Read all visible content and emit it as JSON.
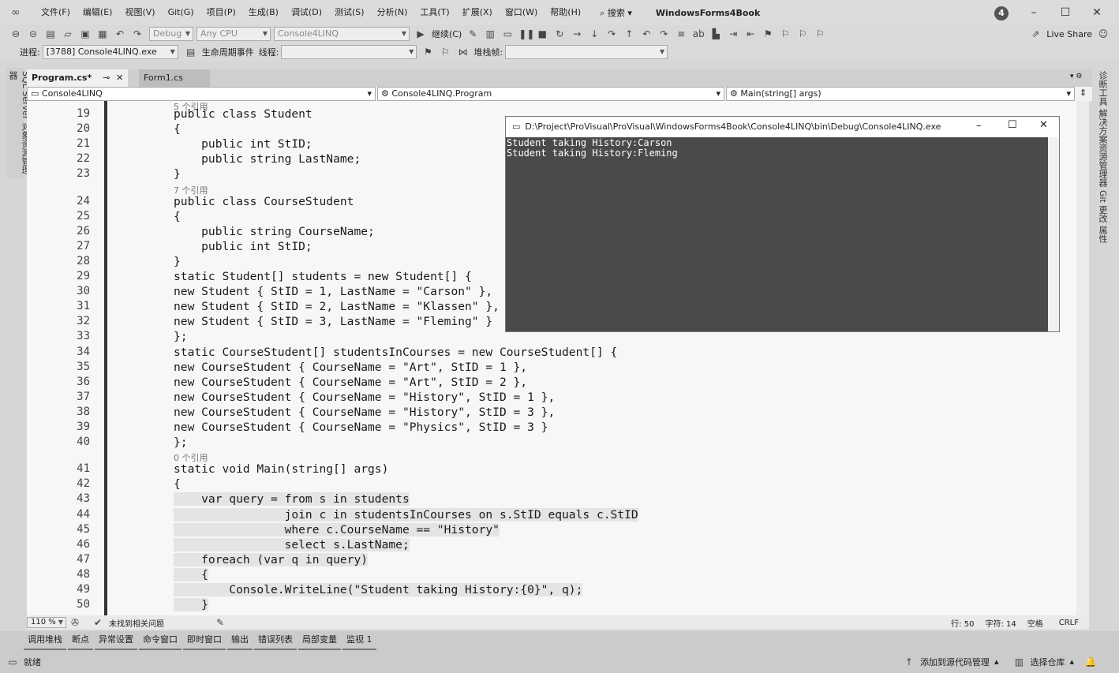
{
  "titlebar": {
    "menus": [
      "文件(F)",
      "编辑(E)",
      "视图(V)",
      "Git(G)",
      "项目(P)",
      "生成(B)",
      "调试(D)",
      "测试(S)",
      "分析(N)",
      "工具(T)",
      "扩展(X)",
      "窗口(W)",
      "帮助(H)"
    ],
    "search_label": "搜索",
    "window_title": "WindowsForms4Book",
    "badge": "4"
  },
  "toolbar1": {
    "config": "Debug",
    "platform": "Any CPU",
    "project": "Console4LINQ",
    "continue_label": "继续(C)",
    "live_share": "Live Share"
  },
  "toolbar2": {
    "process_label": "进程:",
    "process_value": "[3788] Console4LINQ.exe",
    "lifecycle_label": "生命周期事件",
    "thread_label": "线程:",
    "stack_label": "堆栈帧:"
  },
  "left_tab": [
    "SQL Server 对象资源管理器"
  ],
  "right_tab": [
    "诊断工具",
    "解决方案资源管理器",
    "Git 更改",
    "属性"
  ],
  "editor_tabs": [
    "Program.cs*",
    "Form1.cs"
  ],
  "nav": {
    "project": "Console4LINQ",
    "class": "Console4LINQ.Program",
    "member": "Main(string[] args)"
  },
  "code_lines": [
    {
      "n": "19",
      "text": "public class Student",
      "ref": "5 个引用"
    },
    {
      "n": "20",
      "text": "{"
    },
    {
      "n": "21",
      "text": "    public int StID;"
    },
    {
      "n": "22",
      "text": "    public string LastName;"
    },
    {
      "n": "23",
      "text": "}"
    },
    {
      "n": "24",
      "text": "public class CourseStudent",
      "ref": "7 个引用"
    },
    {
      "n": "25",
      "text": "{"
    },
    {
      "n": "26",
      "text": "    public string CourseName;"
    },
    {
      "n": "27",
      "text": "    public int StID;"
    },
    {
      "n": "28",
      "text": "}"
    },
    {
      "n": "29",
      "text": "static Student[] students = new Student[] {"
    },
    {
      "n": "30",
      "text": "new Student { StID = 1, LastName = \"Carson\" },"
    },
    {
      "n": "31",
      "text": "new Student { StID = 2, LastName = \"Klassen\" },"
    },
    {
      "n": "32",
      "text": "new Student { StID = 3, LastName = \"Fleming\" }"
    },
    {
      "n": "33",
      "text": "};"
    },
    {
      "n": "34",
      "text": "static CourseStudent[] studentsInCourses = new CourseStudent[] {"
    },
    {
      "n": "35",
      "text": "new CourseStudent { CourseName = \"Art\", StID = 1 },"
    },
    {
      "n": "36",
      "text": "new CourseStudent { CourseName = \"Art\", StID = 2 },"
    },
    {
      "n": "37",
      "text": "new CourseStudent { CourseName = \"History\", StID = 1 },"
    },
    {
      "n": "38",
      "text": "new CourseStudent { CourseName = \"History\", StID = 3 },"
    },
    {
      "n": "39",
      "text": "new CourseStudent { CourseName = \"Physics\", StID = 3 }"
    },
    {
      "n": "40",
      "text": "};"
    },
    {
      "n": "41",
      "text": "static void Main(string[] args)",
      "ref": "0 个引用"
    },
    {
      "n": "42",
      "text": "{"
    },
    {
      "n": "43",
      "text": "    var query = from s in students"
    },
    {
      "n": "44",
      "text": "                join c in studentsInCourses on s.StID equals c.StID"
    },
    {
      "n": "45",
      "text": "                where c.CourseName == \"History\""
    },
    {
      "n": "46",
      "text": "                select s.LastName;"
    },
    {
      "n": "47",
      "text": "    foreach (var q in query)"
    },
    {
      "n": "48",
      "text": "    {"
    },
    {
      "n": "49",
      "text": "        Console.WriteLine(\"Student taking History:{0}\", q);"
    },
    {
      "n": "50",
      "text": "    }"
    }
  ],
  "console": {
    "title": "D:\\Project\\ProVisual\\ProVisual\\WindowsForms4Book\\Console4LINQ\\bin\\Debug\\Console4LINQ.exe",
    "output": [
      "Student taking History:Carson",
      "Student taking History:Fleming"
    ]
  },
  "editor_status": {
    "zoom": "110 %",
    "issues": "未找到相关问题",
    "line": "行: 50",
    "char": "字符: 14",
    "space": "空格",
    "eol": "CRLF"
  },
  "bottom_tabs": [
    "调用堆栈",
    "断点",
    "异常设置",
    "命令窗口",
    "即时窗口",
    "输出",
    "错误列表",
    "局部变量",
    "监视 1"
  ],
  "statusbar": {
    "ready": "就绪",
    "add_source": "添加到源代码管理",
    "select_repo": "选择仓库"
  }
}
